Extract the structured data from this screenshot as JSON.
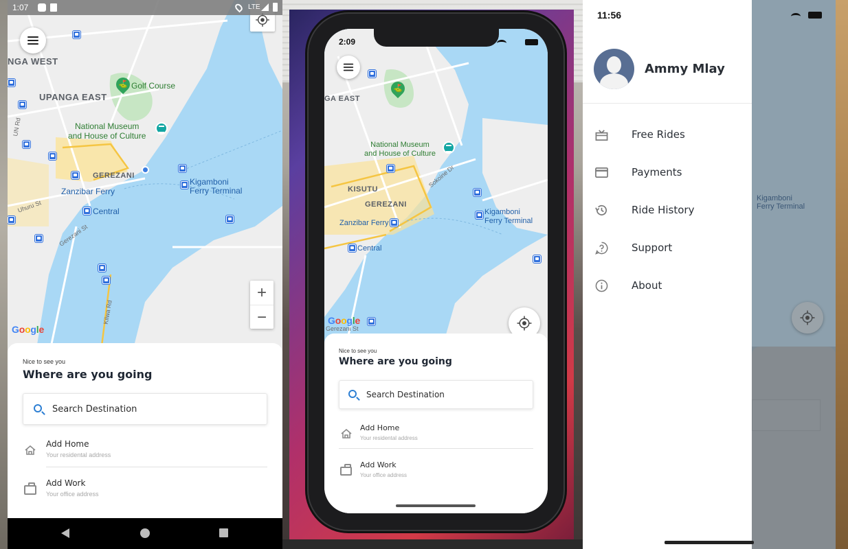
{
  "android": {
    "status_time": "1:07",
    "status_network": "LTE",
    "map": {
      "area_labels": [
        "NGA WEST",
        "UPANGA EAST",
        "GEREZANI"
      ],
      "poi_golf": "Golf Course",
      "poi_museum": "National Museum\nand House of Culture",
      "zanzibar_ferry": "Zanzibar Ferry",
      "central": "Central",
      "kigamboni": "Kigamboni\nFerry Terminal",
      "streets": [
        "Uhuru St",
        "Gerezani St",
        "Kilwa Rd",
        "UN Rd"
      ],
      "zoom_in": "+",
      "zoom_out": "−"
    },
    "sheet": {
      "greeting": "Nice to see you",
      "headline": "Where are you going",
      "search_placeholder": "Search Destination",
      "home_title": "Add Home",
      "home_sub": "Your residental address",
      "work_title": "Add Work",
      "work_sub": "Your office address"
    }
  },
  "iphone": {
    "status_time": "2:09",
    "map": {
      "area_labels": [
        "GA EAST",
        "KISUTU",
        "GEREZANI"
      ],
      "poi_museum": "National Museum\nand House of Culture",
      "zanzibar_ferry": "Zanzibar Ferry",
      "central": "Central",
      "kigamboni": "Kigamboni\nFerry Terminal",
      "streets": [
        "Sokoine Dr",
        "Gerezani St"
      ]
    },
    "sheet": {
      "greeting": "Nice to see you",
      "headline": "Where are you going",
      "search_placeholder": "Search Destination",
      "home_title": "Add Home",
      "home_sub": "Your residental address",
      "work_title": "Add Work",
      "work_sub": "Your office address"
    }
  },
  "drawer": {
    "status_time": "11:56",
    "user_name": "Ammy Mlay",
    "menu": [
      {
        "label": "Free Rides",
        "icon": "gift-icon"
      },
      {
        "label": "Payments",
        "icon": "credit-card-icon"
      },
      {
        "label": "Ride History",
        "icon": "history-icon"
      },
      {
        "label": "Support",
        "icon": "help-icon"
      },
      {
        "label": "About",
        "icon": "info-icon"
      }
    ],
    "background_map_label": "Kigamboni\nFerry Terminal"
  },
  "brand": {
    "google_logo": "Google",
    "accent": "#2d7fd3",
    "water": "#a9d8f5",
    "land": "#eeeeee",
    "park": "#c7e6c4",
    "road_yellow": "#fbe39a"
  }
}
